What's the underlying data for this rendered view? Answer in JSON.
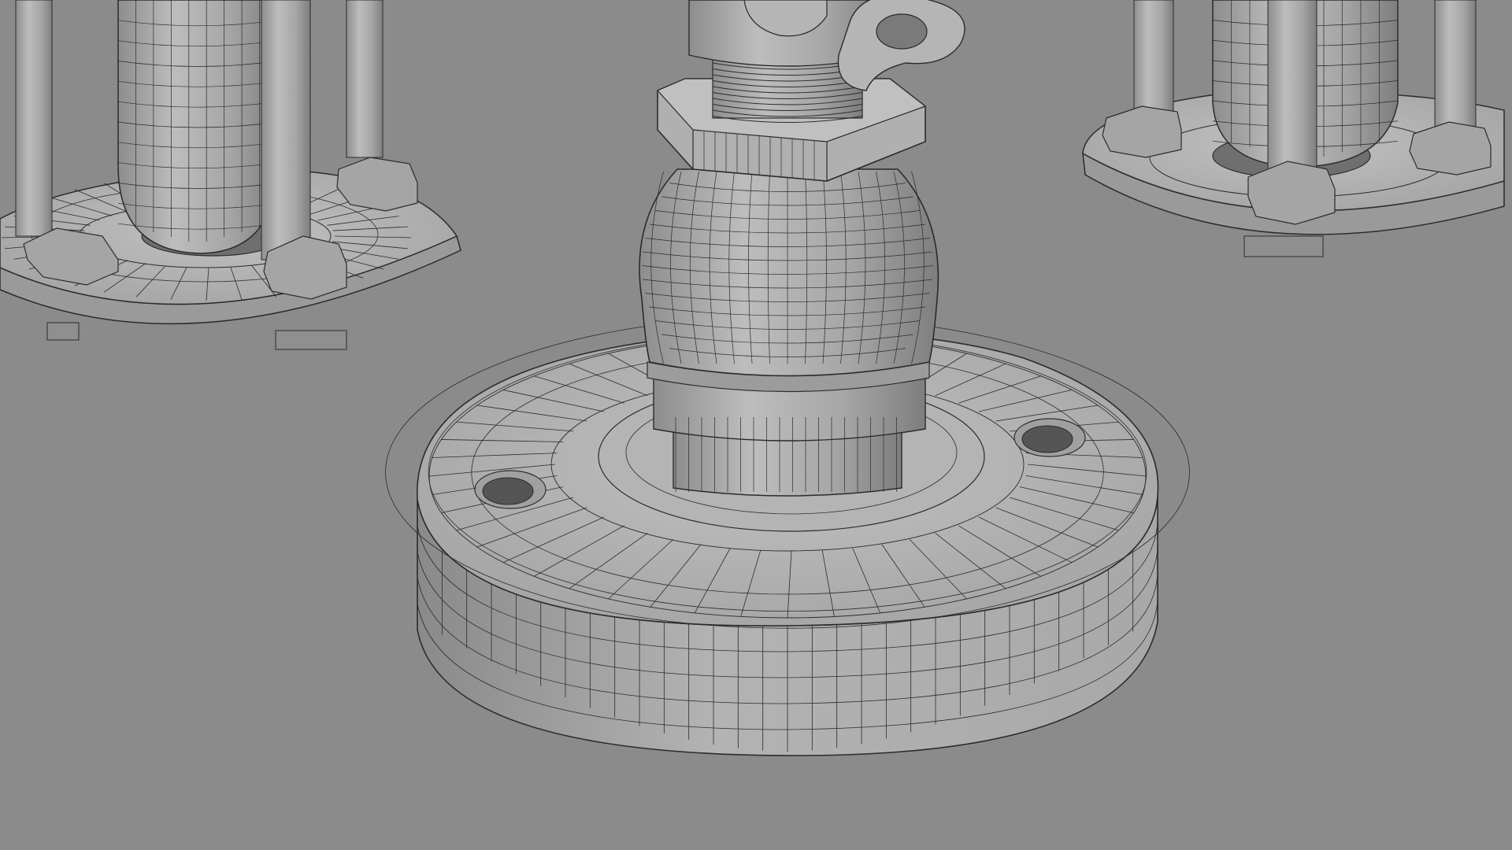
{
  "scene": {
    "background_color": "#8b8b8b",
    "material_light": "#b9b9b9",
    "material_mid": "#a4a4a4",
    "material_dark": "#7a7a7a",
    "wire_color": "#2b2b2b",
    "objects": [
      "flange-base-center",
      "bulb-neck-center",
      "hex-nut-center",
      "threaded-stem-center",
      "shackle-top",
      "bolt-hole-left",
      "bolt-hole-right",
      "flange-left",
      "capsule-left",
      "threaded-rods-left",
      "hex-nuts-left",
      "flange-right",
      "capsule-right",
      "threaded-rods-right",
      "hex-nuts-right"
    ]
  }
}
